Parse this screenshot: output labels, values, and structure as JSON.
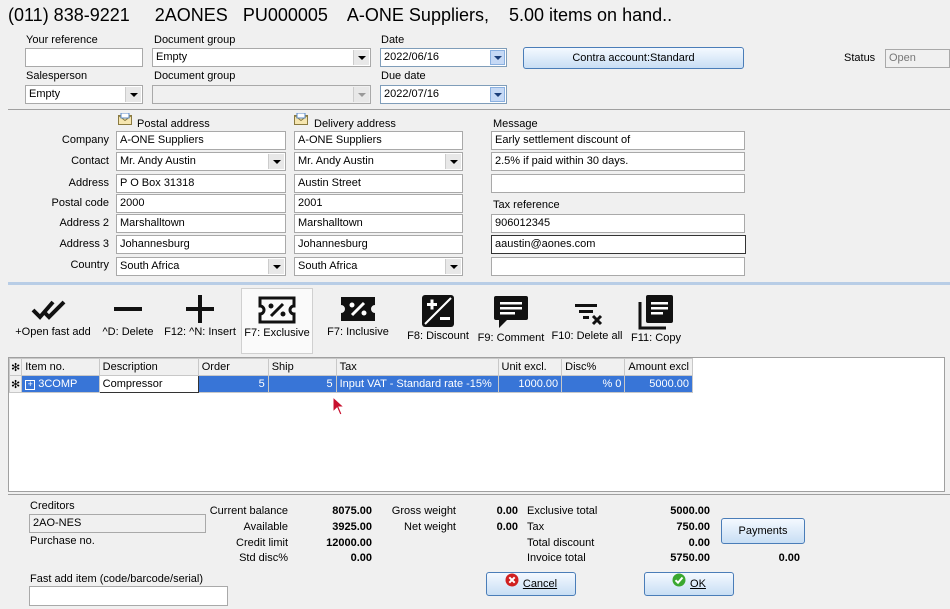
{
  "header": {
    "phone": "(011) 838-9221",
    "code": "2AONES",
    "doc_no": "PU000005",
    "supplier": "A-ONE Suppliers,",
    "on_hand": "5.00 items on hand.."
  },
  "top": {
    "your_reference_label": "Your reference",
    "your_reference_value": "",
    "doc_group_label_1": "Document group",
    "doc_group_value_1": "Empty",
    "date_label": "Date",
    "date_value": "2022/06/16",
    "contra_button": "Contra account:Standard",
    "status_label": "Status",
    "status_value": "Open",
    "salesperson_label": "Salesperson",
    "salesperson_value": "Empty",
    "doc_group_label_2": "Document group",
    "doc_group_value_2": "",
    "due_date_label": "Due date",
    "due_date_value": "2022/07/16"
  },
  "address": {
    "postal_header": "Postal address",
    "delivery_header": "Delivery address",
    "message_header": "Message",
    "labels": {
      "company": "Company",
      "contact": "Contact",
      "address": "Address",
      "postal_code": "Postal code",
      "address2": "Address 2",
      "address3": "Address 3",
      "country": "Country"
    },
    "postal": {
      "company": "A-ONE Suppliers",
      "contact": "Mr. Andy Austin",
      "address": "P O Box 31318",
      "postal_code": "2000",
      "address2": "Marshalltown",
      "address3": "Johannesburg",
      "country": "South Africa"
    },
    "delivery": {
      "company": "A-ONE Suppliers",
      "contact": "Mr. Andy Austin",
      "address": "Austin Street",
      "postal_code": "2001",
      "address2": "Marshalltown",
      "address3": "Johannesburg",
      "country": "South Africa"
    },
    "message_line1": "Early settlement discount of",
    "message_line2": "2.5% if paid within 30 days.",
    "message_line3": "",
    "tax_reference_label": "Tax reference",
    "tax_reference_value": "906012345",
    "email": "aaustin@aones.com",
    "extra": ""
  },
  "toolbar": {
    "fast_add": "+Open fast add",
    "delete": "^D: Delete",
    "insert": "F12: ^N: Insert",
    "exclusive": "F7: Exclusive",
    "inclusive": "F7: Inclusive",
    "discount": "F8: Discount",
    "comment": "F9: Comment",
    "delete_all": "F10: Delete all",
    "copy": "F11: Copy"
  },
  "grid": {
    "columns": [
      "Item no.",
      "Description",
      "Order",
      "Ship",
      "Tax",
      "Unit excl.",
      "Disc%",
      "Amount excl"
    ],
    "rows": [
      {
        "item_no": "3COMP",
        "description": "Compressor",
        "order": "5",
        "ship": "5",
        "tax": "Input VAT - Standard rate -15%",
        "unit_excl": "1000.00",
        "disc": "% 0",
        "amount_excl": "5000.00"
      }
    ]
  },
  "footer": {
    "creditors_label": "Creditors",
    "creditors_value": "2AO-NES",
    "purchase_no_label": "Purchase no.",
    "current_balance_label": "Current balance",
    "current_balance": "8075.00",
    "available_label": "Available",
    "available": "3925.00",
    "credit_limit_label": "Credit limit",
    "credit_limit": "12000.00",
    "std_disc_label": "Std disc%",
    "std_disc": "0.00",
    "gross_weight_label": "Gross weight",
    "gross_weight": "0.00",
    "net_weight_label": "Net weight",
    "net_weight": "0.00",
    "exclusive_total_label": "Exclusive total",
    "exclusive_total": "5000.00",
    "tax_label": "Tax",
    "tax": "750.00",
    "total_discount_label": "Total discount",
    "total_discount": "0.00",
    "invoice_total_label": "Invoice total",
    "invoice_total": "5750.00",
    "payments_button": "Payments",
    "payments_value": "0.00",
    "fast_add_label": "Fast add item (code/barcode/serial)",
    "fast_add_value": "",
    "cancel_button": "Cancel",
    "ok_button": "OK"
  }
}
